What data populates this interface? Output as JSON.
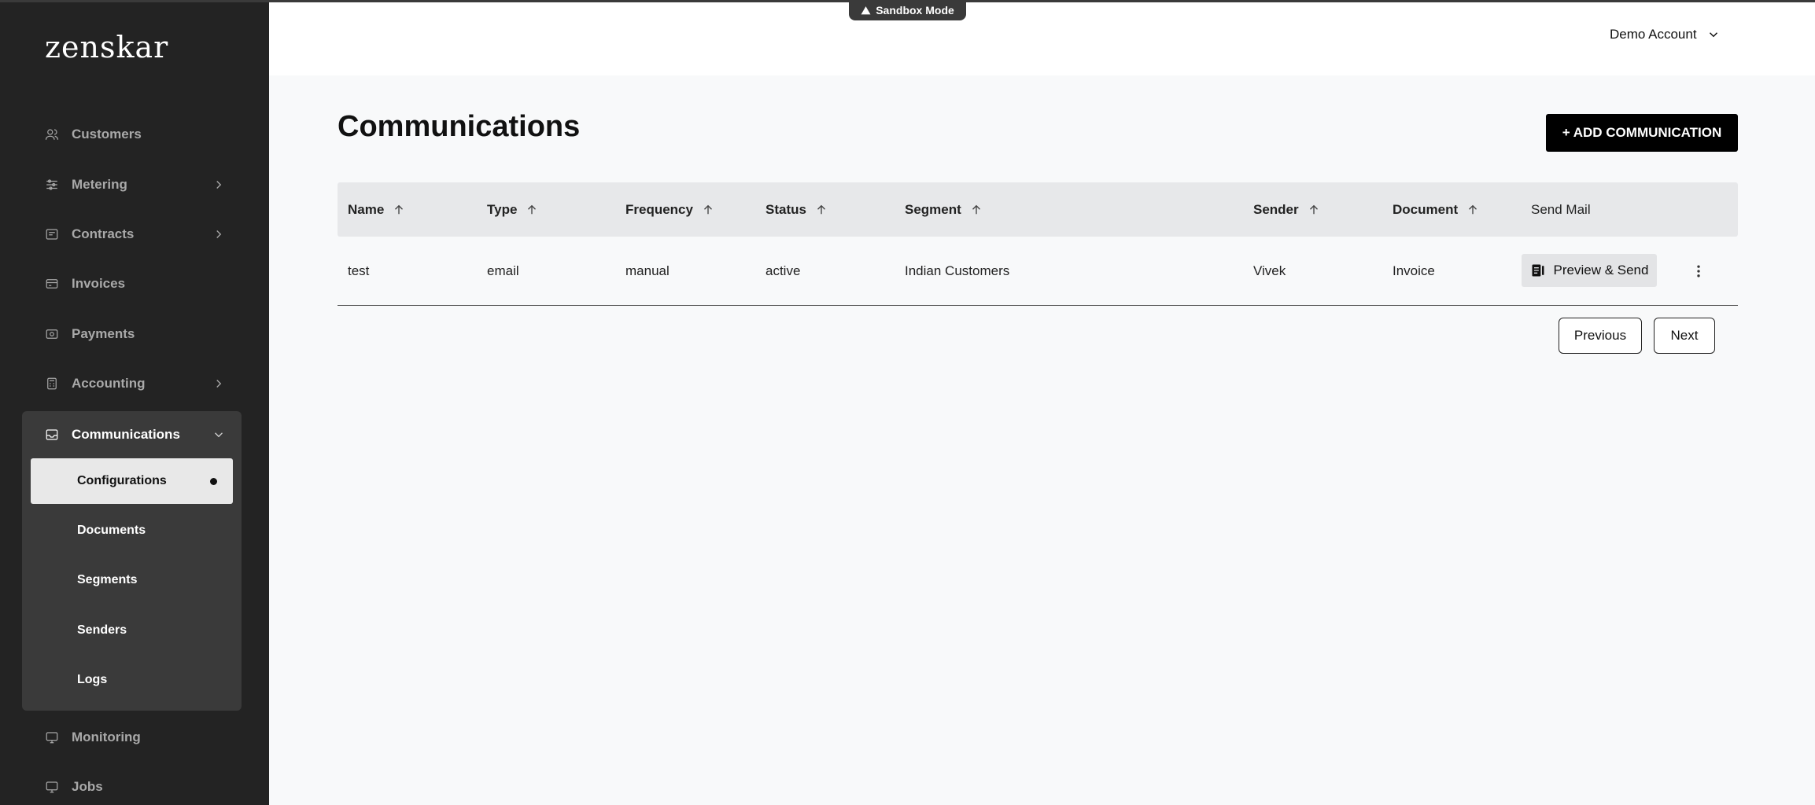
{
  "sandbox": {
    "label": "Sandbox Mode"
  },
  "header": {
    "account": "Demo Account"
  },
  "sidebar": {
    "logo": "zenskar",
    "items": [
      {
        "label": "Customers"
      },
      {
        "label": "Metering"
      },
      {
        "label": "Contracts"
      },
      {
        "label": "Invoices"
      },
      {
        "label": "Payments"
      },
      {
        "label": "Accounting"
      },
      {
        "label": "Communications"
      },
      {
        "label": "Monitoring"
      },
      {
        "label": "Jobs"
      }
    ],
    "communications_sub": [
      {
        "label": "Configurations"
      },
      {
        "label": "Documents"
      },
      {
        "label": "Segments"
      },
      {
        "label": "Senders"
      },
      {
        "label": "Logs"
      }
    ]
  },
  "main": {
    "title": "Communications",
    "add_button": "+ ADD COMMUNICATION",
    "columns": [
      "Name",
      "Type",
      "Frequency",
      "Status",
      "Segment",
      "Sender",
      "Document",
      "Send Mail"
    ],
    "rows": [
      {
        "name": "test",
        "type": "email",
        "frequency": "manual",
        "status": "active",
        "segment": "Indian Customers",
        "sender": "Vivek",
        "document": "Invoice"
      }
    ],
    "preview_button": "Preview & Send",
    "pagination": {
      "previous": "Previous",
      "next": "Next"
    }
  }
}
